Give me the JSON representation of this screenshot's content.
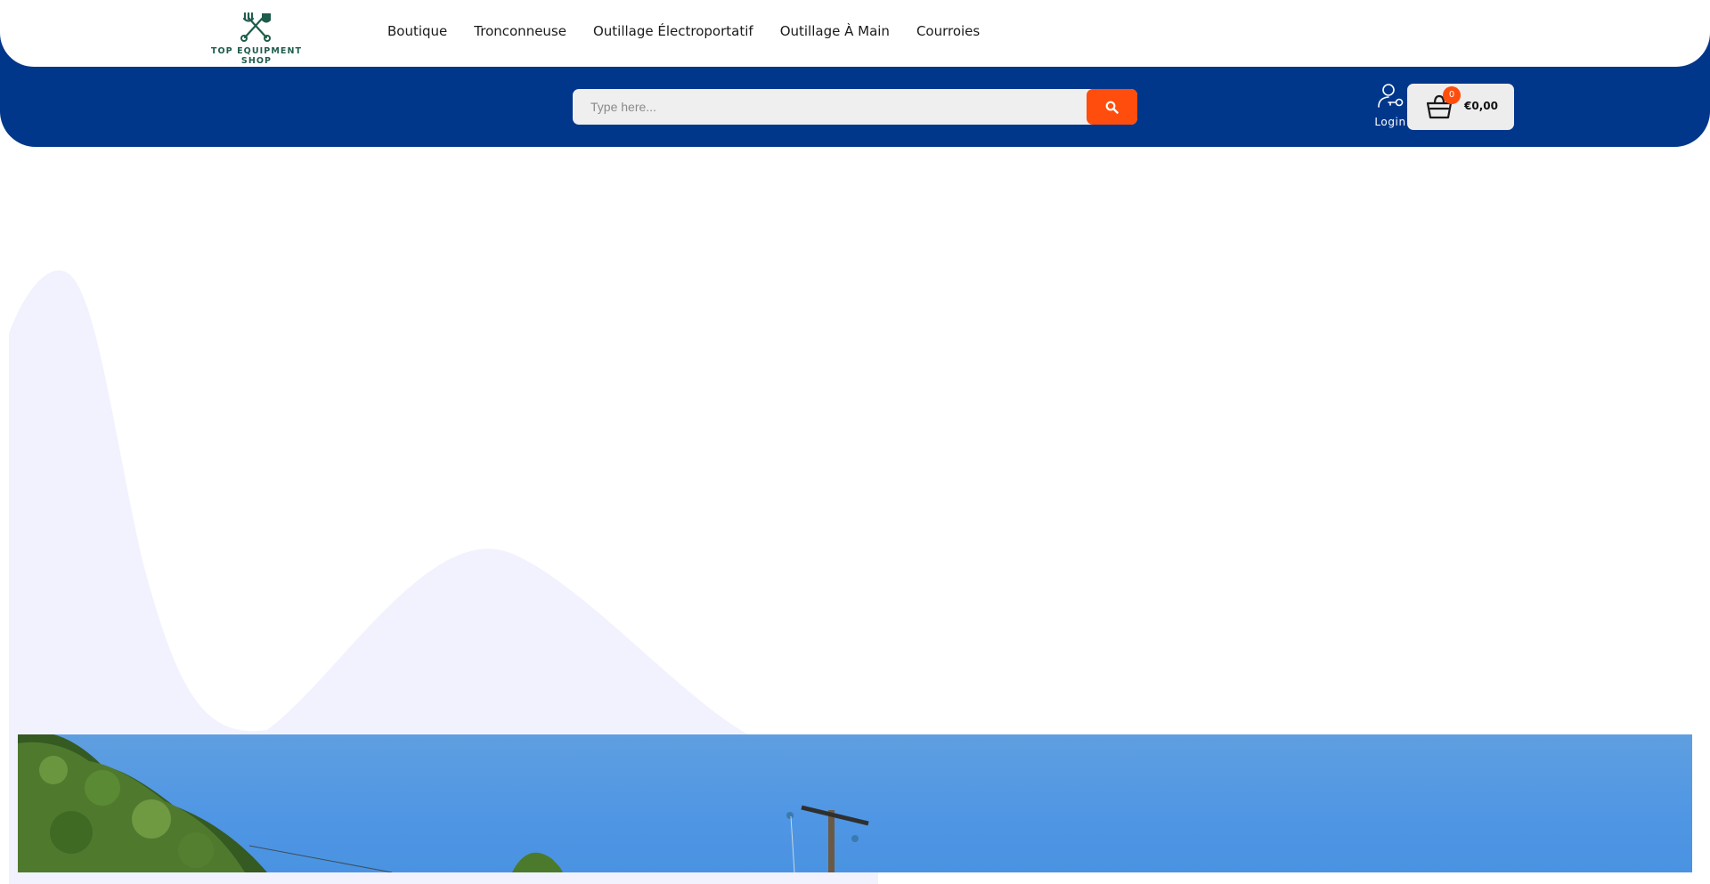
{
  "brand": {
    "name": "TOP EQUIPMENT SHOP",
    "color": "#1e5c4c"
  },
  "nav": {
    "items": [
      {
        "label": "Boutique"
      },
      {
        "label": "Tronconneuse"
      },
      {
        "label": "Outillage Électroportatif"
      },
      {
        "label": "Outillage À Main"
      },
      {
        "label": "Courroies"
      }
    ]
  },
  "search": {
    "placeholder": "Type here...",
    "value": "",
    "button_icon": "search-icon"
  },
  "account": {
    "login_label": "Login",
    "icon": "user-key-icon"
  },
  "cart": {
    "count": "0",
    "total": "€0,00",
    "icon": "shopping-basket-icon"
  },
  "colors": {
    "header_blue": "#00378b",
    "accent_orange": "#ff4d0d",
    "wave_lavender": "#f1f2fe"
  }
}
